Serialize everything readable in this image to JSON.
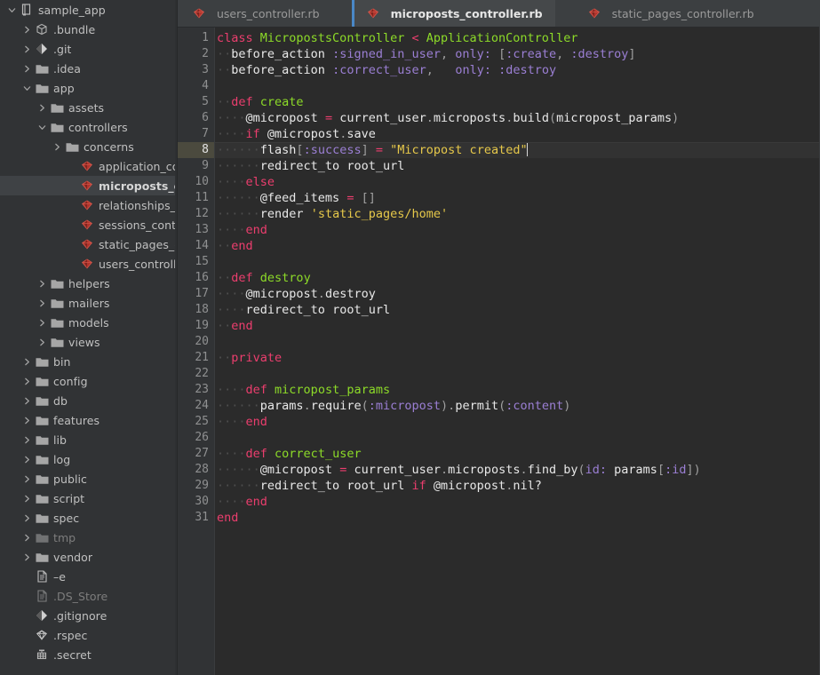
{
  "sidebar": {
    "project_name": "sample_app",
    "items": [
      {
        "label": "sample_app",
        "depth": 0,
        "arrow": "down",
        "icon": "project-module-icon",
        "dim": false,
        "selected": false
      },
      {
        "label": ".bundle",
        "depth": 1,
        "arrow": "right",
        "icon": "package-icon",
        "dim": false,
        "selected": false
      },
      {
        "label": ".git",
        "depth": 1,
        "arrow": "right",
        "icon": "git-icon",
        "dim": false,
        "selected": false
      },
      {
        "label": ".idea",
        "depth": 1,
        "arrow": "right",
        "icon": "folder-icon",
        "dim": false,
        "selected": false
      },
      {
        "label": "app",
        "depth": 1,
        "arrow": "down",
        "icon": "folder-icon",
        "dim": false,
        "selected": false
      },
      {
        "label": "assets",
        "depth": 2,
        "arrow": "right",
        "icon": "folder-icon",
        "dim": false,
        "selected": false
      },
      {
        "label": "controllers",
        "depth": 2,
        "arrow": "down",
        "icon": "folder-icon",
        "dim": false,
        "selected": false
      },
      {
        "label": "concerns",
        "depth": 3,
        "arrow": "right",
        "icon": "folder-icon",
        "dim": false,
        "selected": false
      },
      {
        "label": "application_controll",
        "depth": 4,
        "arrow": "none",
        "icon": "ruby-icon",
        "dim": false,
        "selected": false
      },
      {
        "label": "microposts_controll",
        "depth": 4,
        "arrow": "none",
        "icon": "ruby-icon",
        "dim": false,
        "selected": true
      },
      {
        "label": "relationships_contro",
        "depth": 4,
        "arrow": "none",
        "icon": "ruby-icon",
        "dim": false,
        "selected": false
      },
      {
        "label": "sessions_controller.",
        "depth": 4,
        "arrow": "none",
        "icon": "ruby-icon",
        "dim": false,
        "selected": false
      },
      {
        "label": "static_pages_contro",
        "depth": 4,
        "arrow": "none",
        "icon": "ruby-icon",
        "dim": false,
        "selected": false
      },
      {
        "label": "users_controller.rb",
        "depth": 4,
        "arrow": "none",
        "icon": "ruby-icon",
        "dim": false,
        "selected": false
      },
      {
        "label": "helpers",
        "depth": 2,
        "arrow": "right",
        "icon": "folder-icon",
        "dim": false,
        "selected": false
      },
      {
        "label": "mailers",
        "depth": 2,
        "arrow": "right",
        "icon": "folder-icon",
        "dim": false,
        "selected": false
      },
      {
        "label": "models",
        "depth": 2,
        "arrow": "right",
        "icon": "folder-icon",
        "dim": false,
        "selected": false
      },
      {
        "label": "views",
        "depth": 2,
        "arrow": "right",
        "icon": "folder-icon",
        "dim": false,
        "selected": false
      },
      {
        "label": "bin",
        "depth": 1,
        "arrow": "right",
        "icon": "folder-icon",
        "dim": false,
        "selected": false
      },
      {
        "label": "config",
        "depth": 1,
        "arrow": "right",
        "icon": "folder-icon",
        "dim": false,
        "selected": false
      },
      {
        "label": "db",
        "depth": 1,
        "arrow": "right",
        "icon": "folder-icon",
        "dim": false,
        "selected": false
      },
      {
        "label": "features",
        "depth": 1,
        "arrow": "right",
        "icon": "folder-icon",
        "dim": false,
        "selected": false
      },
      {
        "label": "lib",
        "depth": 1,
        "arrow": "right",
        "icon": "folder-icon",
        "dim": false,
        "selected": false
      },
      {
        "label": "log",
        "depth": 1,
        "arrow": "right",
        "icon": "folder-icon",
        "dim": false,
        "selected": false
      },
      {
        "label": "public",
        "depth": 1,
        "arrow": "right",
        "icon": "folder-icon",
        "dim": false,
        "selected": false
      },
      {
        "label": "script",
        "depth": 1,
        "arrow": "right",
        "icon": "folder-icon",
        "dim": false,
        "selected": false
      },
      {
        "label": "spec",
        "depth": 1,
        "arrow": "right",
        "icon": "folder-icon",
        "dim": false,
        "selected": false
      },
      {
        "label": "tmp",
        "depth": 1,
        "arrow": "right",
        "icon": "folder-icon",
        "dim": true,
        "selected": false
      },
      {
        "label": "vendor",
        "depth": 1,
        "arrow": "right",
        "icon": "folder-icon",
        "dim": false,
        "selected": false
      },
      {
        "label": "–e",
        "depth": 1,
        "arrow": "none",
        "icon": "file-icon",
        "dim": false,
        "selected": false
      },
      {
        "label": ".DS_Store",
        "depth": 1,
        "arrow": "none",
        "icon": "file-icon",
        "dim": true,
        "selected": false
      },
      {
        "label": ".gitignore",
        "depth": 1,
        "arrow": "none",
        "icon": "git-icon",
        "dim": false,
        "selected": false
      },
      {
        "label": ".rspec",
        "depth": 1,
        "arrow": "none",
        "icon": "rspec-icon",
        "dim": false,
        "selected": false
      },
      {
        "label": ".secret",
        "depth": 1,
        "arrow": "none",
        "icon": "secret-icon",
        "dim": false,
        "selected": false
      }
    ]
  },
  "tabs": [
    {
      "label": "users_controller.rb",
      "icon": "ruby-icon",
      "active": false
    },
    {
      "label": "microposts_controller.rb",
      "icon": "ruby-icon",
      "active": true
    },
    {
      "label": "static_pages_controller.rb",
      "icon": "ruby-icon",
      "active": false
    }
  ],
  "editor": {
    "active_line": 8,
    "total_lines": 31,
    "line_numbers": [
      "1",
      "2",
      "3",
      "4",
      "5",
      "6",
      "7",
      "8",
      "9",
      "10",
      "11",
      "12",
      "13",
      "14",
      "15",
      "16",
      "17",
      "18",
      "19",
      "20",
      "21",
      "22",
      "23",
      "24",
      "25",
      "26",
      "27",
      "28",
      "29",
      "30",
      "31"
    ],
    "lines": [
      {
        "n": 1,
        "text": "class MicropostsController < ApplicationController"
      },
      {
        "n": 2,
        "text": "  before_action :signed_in_user, only: [:create, :destroy]"
      },
      {
        "n": 3,
        "text": "  before_action :correct_user,   only: :destroy"
      },
      {
        "n": 4,
        "text": ""
      },
      {
        "n": 5,
        "text": "  def create"
      },
      {
        "n": 6,
        "text": "    @micropost = current_user.microposts.build(micropost_params)"
      },
      {
        "n": 7,
        "text": "    if @micropost.save"
      },
      {
        "n": 8,
        "text": "      flash[:success] = \"Micropost created\""
      },
      {
        "n": 9,
        "text": "      redirect_to root_url"
      },
      {
        "n": 10,
        "text": "    else"
      },
      {
        "n": 11,
        "text": "      @feed_items = []"
      },
      {
        "n": 12,
        "text": "      render 'static_pages/home'"
      },
      {
        "n": 13,
        "text": "    end"
      },
      {
        "n": 14,
        "text": "  end"
      },
      {
        "n": 15,
        "text": ""
      },
      {
        "n": 16,
        "text": "  def destroy"
      },
      {
        "n": 17,
        "text": "    @micropost.destroy"
      },
      {
        "n": 18,
        "text": "    redirect_to root_url"
      },
      {
        "n": 19,
        "text": "  end"
      },
      {
        "n": 20,
        "text": ""
      },
      {
        "n": 21,
        "text": "  private"
      },
      {
        "n": 22,
        "text": ""
      },
      {
        "n": 23,
        "text": "    def micropost_params"
      },
      {
        "n": 24,
        "text": "      params.require(:micropost).permit(:content)"
      },
      {
        "n": 25,
        "text": "    end"
      },
      {
        "n": 26,
        "text": ""
      },
      {
        "n": 27,
        "text": "    def correct_user"
      },
      {
        "n": 28,
        "text": "      @micropost = current_user.microposts.find_by(id: params[:id])"
      },
      {
        "n": 29,
        "text": "      redirect_to root_url if @micropost.nil?"
      },
      {
        "n": 30,
        "text": "    end"
      },
      {
        "n": 31,
        "text": "end"
      }
    ]
  },
  "colors": {
    "sidebar_bg": "#313335",
    "editor_bg": "#2b2b2b",
    "tabbar_bg": "#3c3f41",
    "active_tab_bg": "#45484a",
    "active_tab_accent": "#4a88c7",
    "gutter_bg": "#313335",
    "current_line_bg": "#323232",
    "current_line_gutter_bg": "#4b4a3e",
    "keyword": "#ec3e6e",
    "class_name": "#8ddb28",
    "symbol": "#9b7fd4",
    "string": "#e6c84a",
    "plain_text": "#e8e8e8",
    "ruby_icon": "#c0392b"
  }
}
